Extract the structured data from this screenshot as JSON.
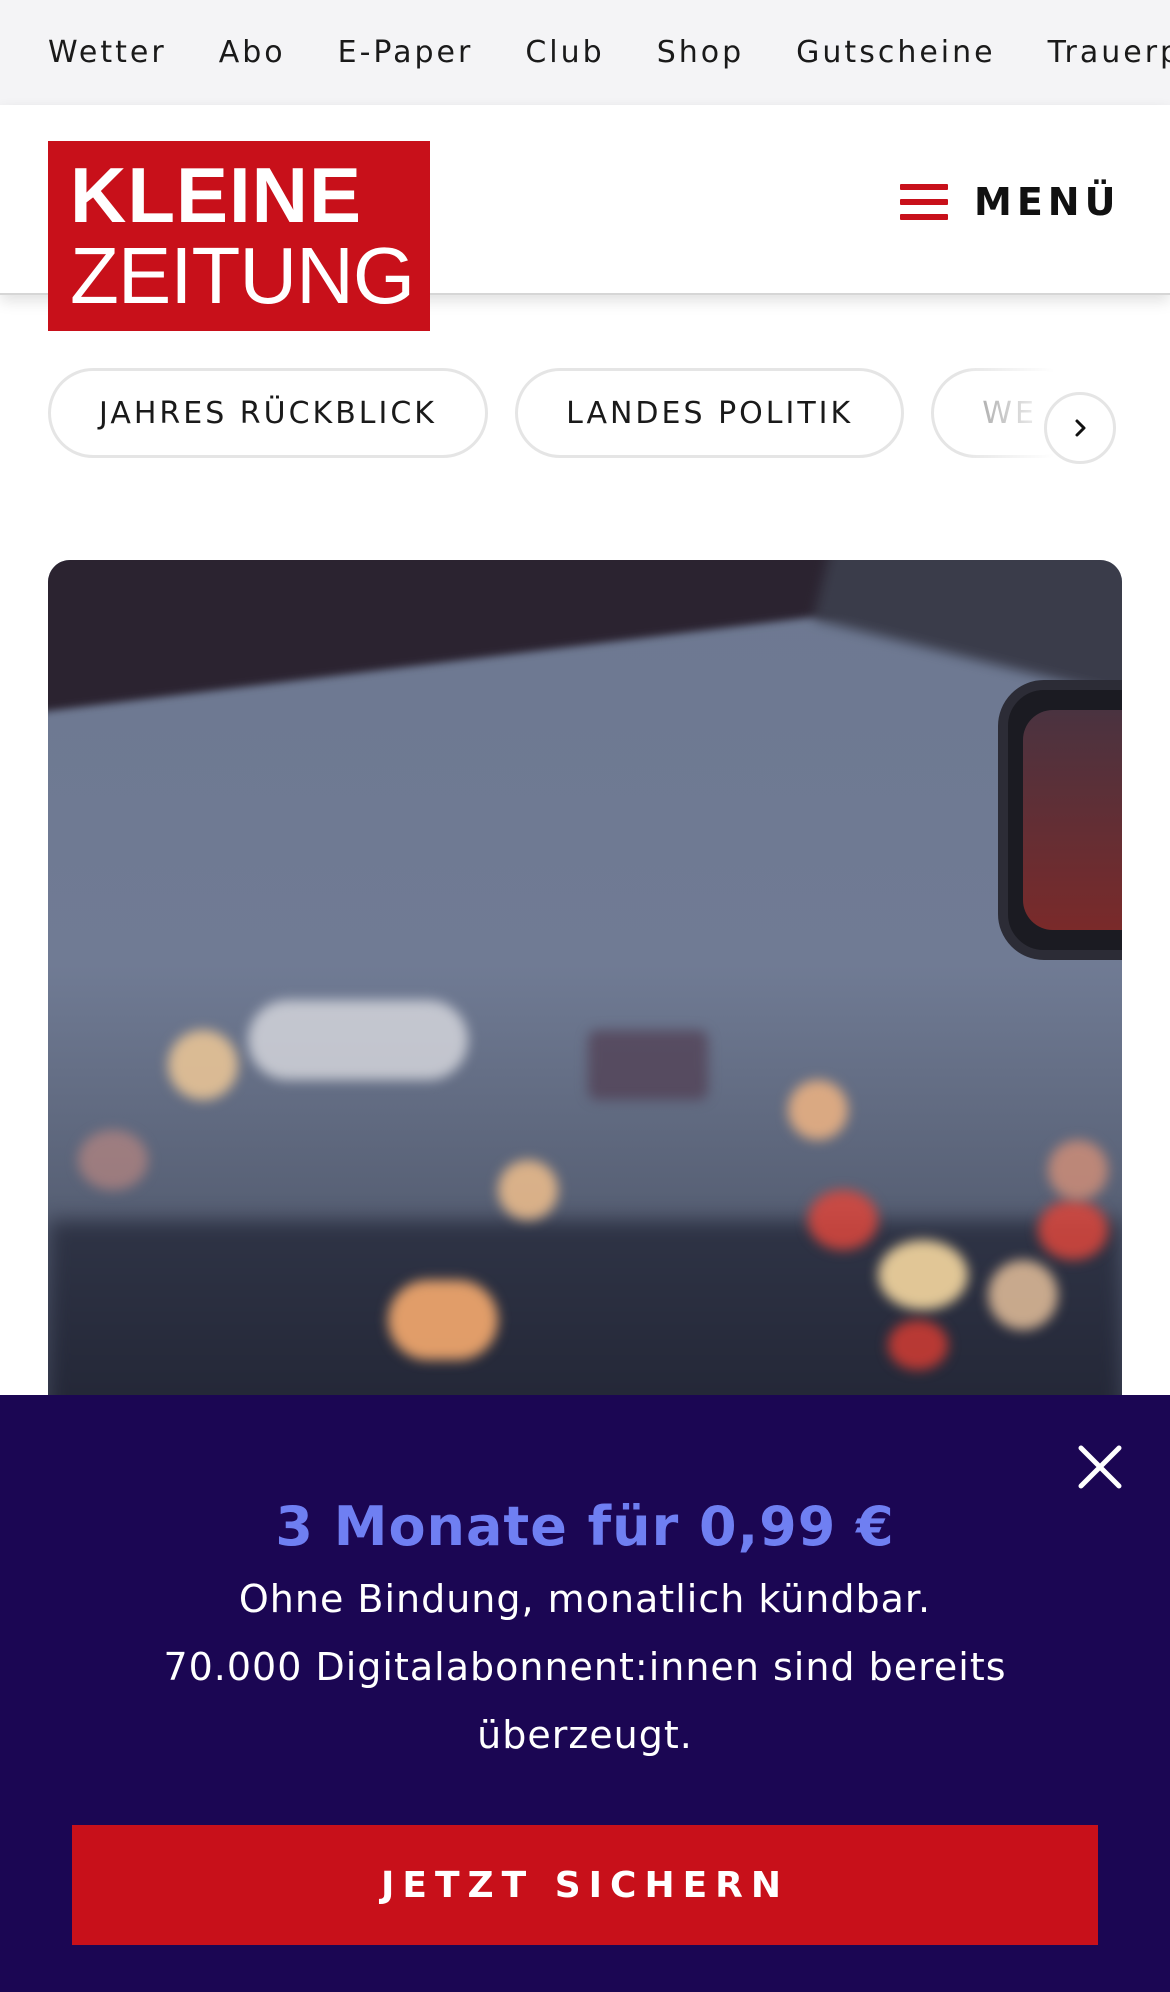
{
  "topnav": {
    "links": [
      "Wetter",
      "Abo",
      "E-Paper",
      "Club",
      "Shop",
      "Gutscheine",
      "Trauerp"
    ]
  },
  "header": {
    "logo_line1": "KLEINE",
    "logo_line2": "ZEITUNG",
    "menu_label": "MENÜ"
  },
  "categories": {
    "chips": [
      "JAHRES RÜCKBLICK",
      "LANDES POLITIK",
      "WE"
    ]
  },
  "hero": {
    "icon": "hero-photo"
  },
  "paywall": {
    "offer_title": "3 Monate für 0,99 €",
    "line1": "Ohne Bindung, monatlich kündbar.",
    "line2": "70.000 Digitalabonnent:innen sind bereits",
    "line3": "überzeugt.",
    "cta_label": "JETZT SICHERN"
  },
  "colors": {
    "brand_red": "#c8101a",
    "paywall_bg": "#1b0653",
    "offer_accent": "#6f7ff2",
    "topbar_bg": "#f4f4f6"
  }
}
